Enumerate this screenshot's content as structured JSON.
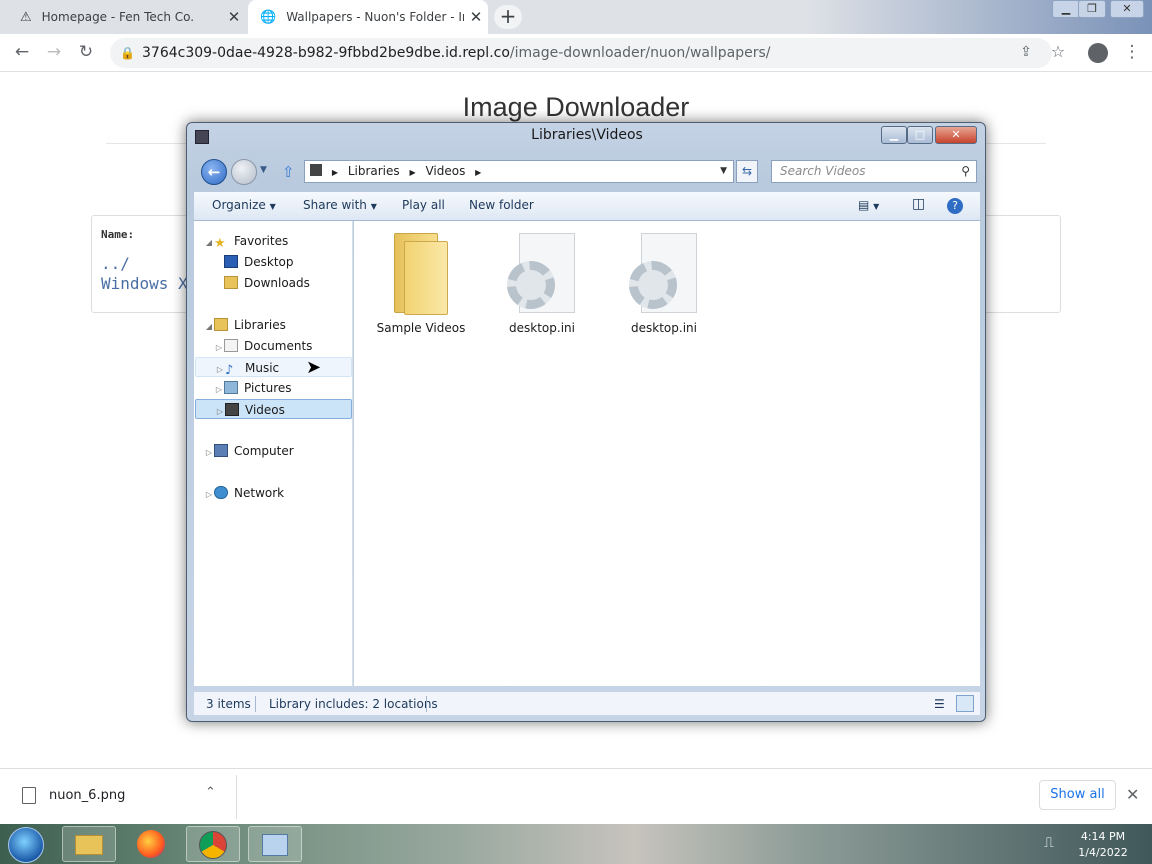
{
  "browser": {
    "tabs": [
      {
        "title": "Homepage - Fen Tech Co.",
        "active": false
      },
      {
        "title": "Wallpapers - Nuon's Folder - Ima",
        "active": true
      }
    ],
    "url_host": "3764c309-0dae-4928-b982-9fbbd2be9dbe.id.repl.co",
    "url_path": "/image-downloader/nuon/wallpapers/"
  },
  "page": {
    "title": "Image Downloader",
    "name_header": "Name:",
    "links": [
      "../",
      "Windows X"
    ]
  },
  "explorer": {
    "title": "Libraries\\Videos",
    "breadcrumb": [
      "Libraries",
      "Videos"
    ],
    "search_placeholder": "Search Videos",
    "commands": [
      "Organize",
      "Share with",
      "Play all",
      "New folder"
    ],
    "nav": {
      "favorites": {
        "label": "Favorites",
        "items": [
          "Desktop",
          "Downloads"
        ]
      },
      "libraries": {
        "label": "Libraries",
        "items": [
          "Documents",
          "Music",
          "Pictures",
          "Videos"
        ]
      },
      "computer": "Computer",
      "network": "Network"
    },
    "files": [
      "Sample Videos",
      "desktop.ini",
      "desktop.ini"
    ],
    "status": {
      "count": "3 items",
      "info": "Library includes: 2 locations"
    }
  },
  "download_shelf": {
    "file": "nuon_6.png",
    "show_all": "Show all"
  },
  "taskbar": {
    "time": "4:14 PM",
    "date": "1/4/2022"
  },
  "colors": {
    "selection": "#cce4f7",
    "explorer_frame": "#b9cade",
    "link": "#4a6fa5"
  }
}
